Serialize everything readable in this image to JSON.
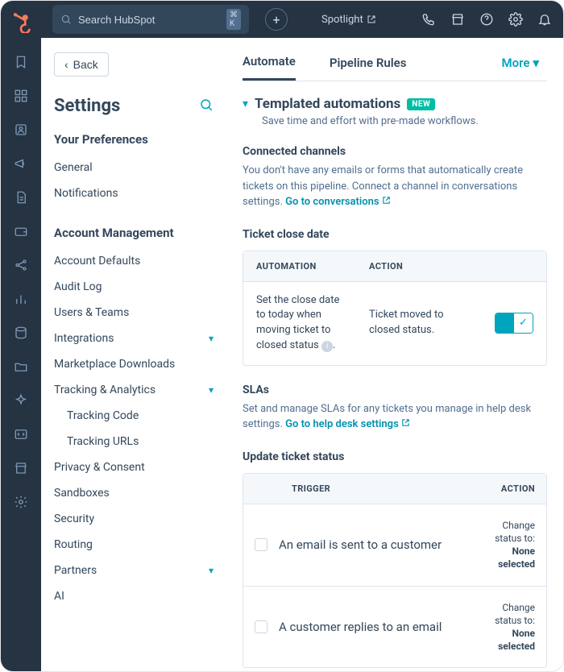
{
  "topbar": {
    "search_placeholder": "Search HubSpot",
    "kbd": "⌘ K",
    "spotlight": "Spotlight"
  },
  "back_label": "Back",
  "settings_title": "Settings",
  "sections": {
    "pref_heading": "Your Preferences",
    "pref_items": [
      "General",
      "Notifications"
    ],
    "acct_heading": "Account Management",
    "acct": {
      "defaults": "Account Defaults",
      "audit": "Audit Log",
      "users": "Users & Teams",
      "integrations": "Integrations",
      "marketplace": "Marketplace Downloads",
      "tracking": "Tracking & Analytics",
      "tracking_code": "Tracking Code",
      "tracking_urls": "Tracking URLs",
      "privacy": "Privacy & Consent",
      "sandboxes": "Sandboxes",
      "security": "Security",
      "routing": "Routing",
      "partners": "Partners",
      "ai": "AI"
    }
  },
  "tabs": {
    "automate": "Automate",
    "pipeline": "Pipeline Rules",
    "more": "More"
  },
  "templated": {
    "title": "Templated automations",
    "badge": "NEW",
    "sub": "Save time and effort with pre-made workflows."
  },
  "connected": {
    "title": "Connected channels",
    "desc": "You don't have any emails or forms that automatically create tickets on this pipeline. Connect a channel in conversations settings. ",
    "link": "Go to conversations"
  },
  "closeDate": {
    "title": "Ticket close date",
    "col_a": "Automation",
    "col_b": "Action",
    "automation": "Set the close date to today when moving ticket to closed status",
    "action": "Ticket moved to closed status."
  },
  "slas": {
    "title": "SLAs",
    "desc": "Set and manage SLAs for any tickets you manage in help desk settings. ",
    "link": "Go to help desk settings"
  },
  "updateStatus": {
    "title": "Update ticket status",
    "col_trigger": "Trigger",
    "col_action": "Action",
    "rows": [
      {
        "trigger": "An email is sent to a customer",
        "action_prefix": "Change status to:",
        "action_value": "None selected"
      },
      {
        "trigger": "A customer replies to an email",
        "action_prefix": "Change status to:",
        "action_value": "None selected"
      }
    ]
  }
}
